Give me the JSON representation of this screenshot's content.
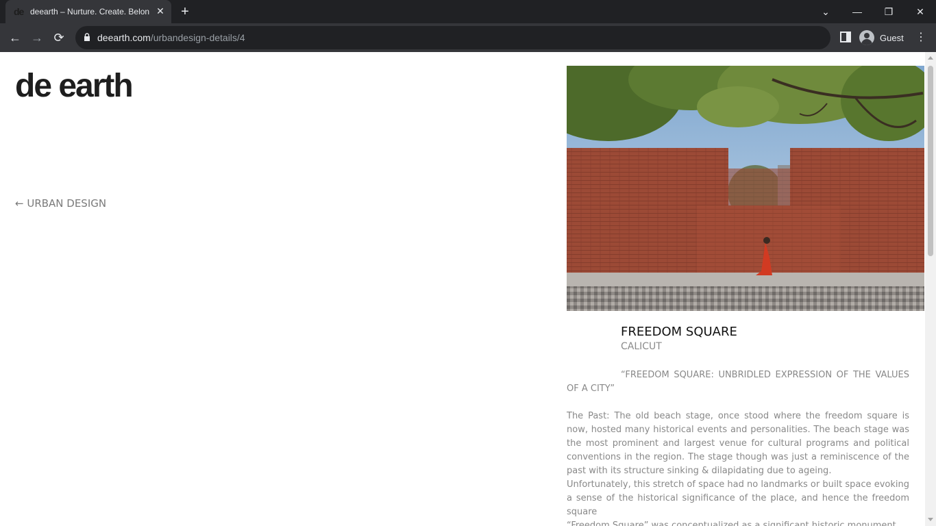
{
  "browser": {
    "tab_title": "deearth – Nurture. Create. Belon",
    "favicon_text": "de",
    "url_domain": "deearth.com",
    "url_path": "/urbandesign-details/4",
    "profile_label": "Guest"
  },
  "site": {
    "logo": "de earth",
    "back_link": "← URBAN DESIGN"
  },
  "project": {
    "title": "FREEDOM SQUARE",
    "location": "CALICUT",
    "quote": "“FREEDOM SQUARE: UNBRIDLED EXPRESSION OF THE VALUES OF A CITY”",
    "paragraphs": [
      "The Past: The old beach stage, once stood where the freedom square is now, hosted many historical events and personalities. The beach stage was the most prominent and largest venue for cultural programs and political conventions in the region. The stage though was just a reminiscence of the past with its structure sinking & dilapidating due to ageing.",
      "Unfortunately, this stretch of space had no landmarks or built space evoking a sense of the historical significance of the place, and hence the freedom square",
      "“Freedom Square” was conceptualized as a significant historic monument"
    ]
  },
  "icons": {
    "close": "close-icon",
    "plus": "plus-icon"
  }
}
